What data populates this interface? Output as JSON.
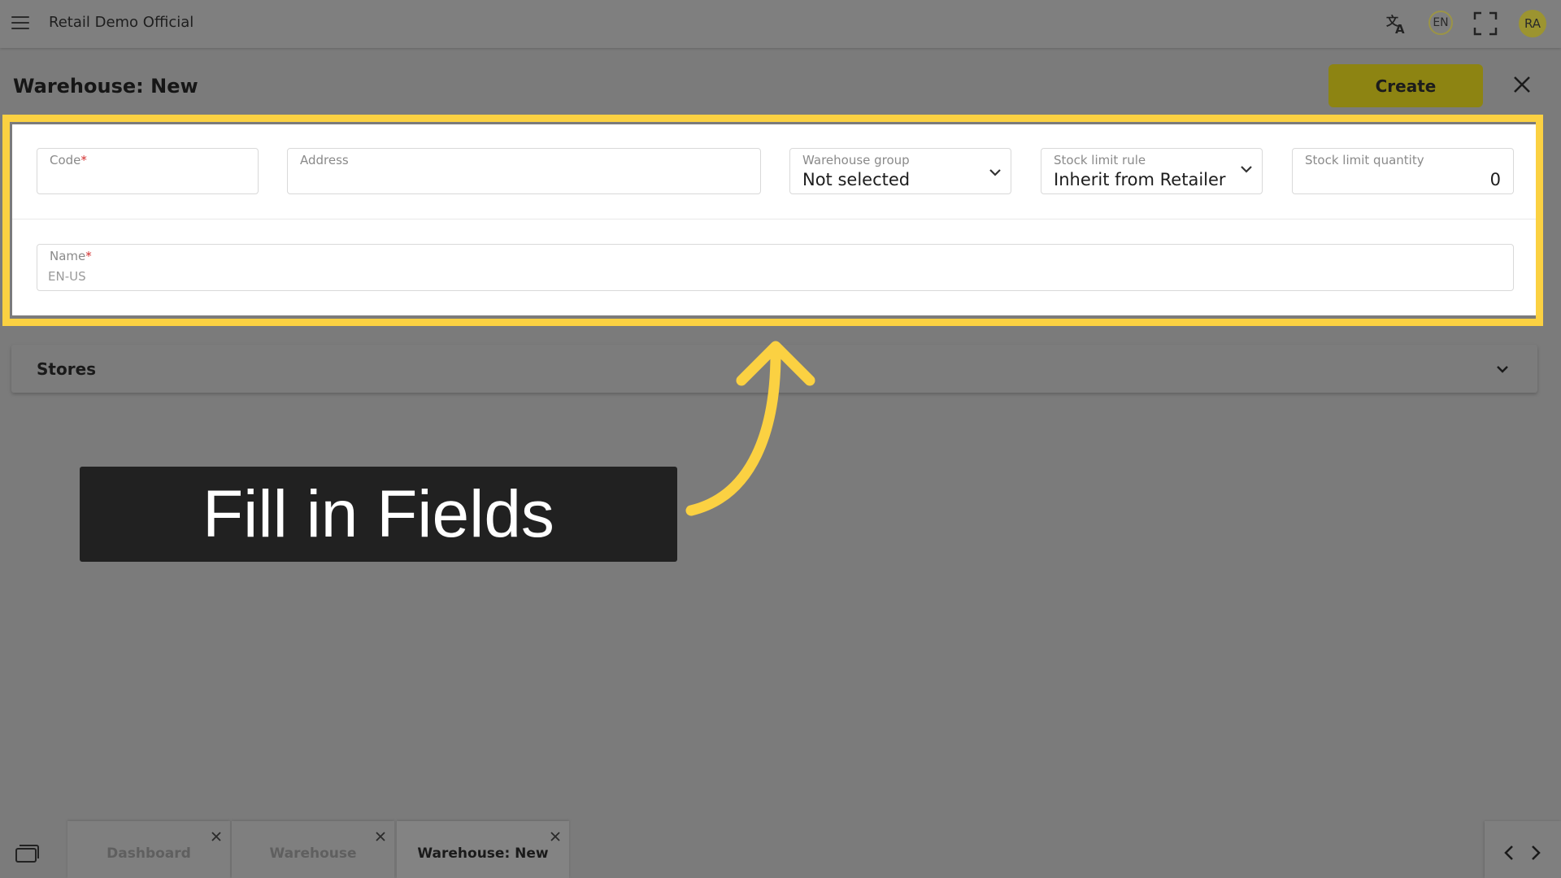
{
  "topbar": {
    "menu_icon": "hamburger-menu-icon",
    "app_title": "Retail Demo Official",
    "translate_icon": "translate-icon",
    "language": "EN",
    "fullscreen_icon": "fullscreen-icon",
    "avatar_initials": "RA"
  },
  "page": {
    "title": "Warehouse: New",
    "create_label": "Create",
    "close_icon": "close-icon"
  },
  "form": {
    "code": {
      "label": "Code",
      "required": "*",
      "value": ""
    },
    "address": {
      "label": "Address",
      "value": ""
    },
    "warehouse_group": {
      "label": "Warehouse group",
      "value": "Not selected"
    },
    "stock_limit_rule": {
      "label": "Stock limit rule",
      "value": "Inherit from Retailer ("
    },
    "stock_limit_quantity": {
      "label": "Stock limit quantity",
      "value": "0"
    },
    "name": {
      "label": "Name",
      "required": "*",
      "placeholder": "EN-US"
    }
  },
  "stores": {
    "title": "Stores"
  },
  "callout": {
    "text": "Fill in Fields"
  },
  "bottom_tabs": [
    {
      "label": "Dashboard",
      "active": false
    },
    {
      "label": "Warehouse",
      "active": false
    },
    {
      "label": "Warehouse: New",
      "active": true
    }
  ],
  "colors": {
    "highlight": "#fbd142",
    "create_button": "#8d8412",
    "overlay": "#7b7b7b",
    "callout_bg": "#212121",
    "required": "#d32f2f"
  }
}
